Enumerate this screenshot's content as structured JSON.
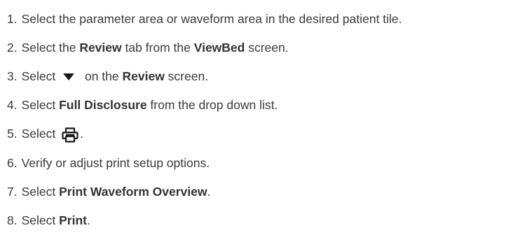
{
  "steps": [
    {
      "num": "1.",
      "t1": "Select the parameter area or waveform area in the desired patient tile."
    },
    {
      "num": "2.",
      "t1": "Select the ",
      "b1": "Review",
      "t2": " tab from the ",
      "b2": "ViewBed",
      "t3": " screen."
    },
    {
      "num": "3.",
      "t1": "Select ",
      "icon": "dropdown-triangle-icon",
      "t2": " on the ",
      "b1": "Review",
      "t3": " screen."
    },
    {
      "num": "4.",
      "t1": "Select ",
      "b1": "Full Disclosure",
      "t2": " from the drop down list."
    },
    {
      "num": "5.",
      "t1": "Select ",
      "icon": "printer-icon",
      "t2": "."
    },
    {
      "num": "6.",
      "t1": "Verify or adjust print setup options."
    },
    {
      "num": "7.",
      "t1": "Select ",
      "b1": "Print Waveform Overview",
      "t2": "."
    },
    {
      "num": "8.",
      "t1": "Select ",
      "b1": "Print",
      "t2": "."
    }
  ]
}
